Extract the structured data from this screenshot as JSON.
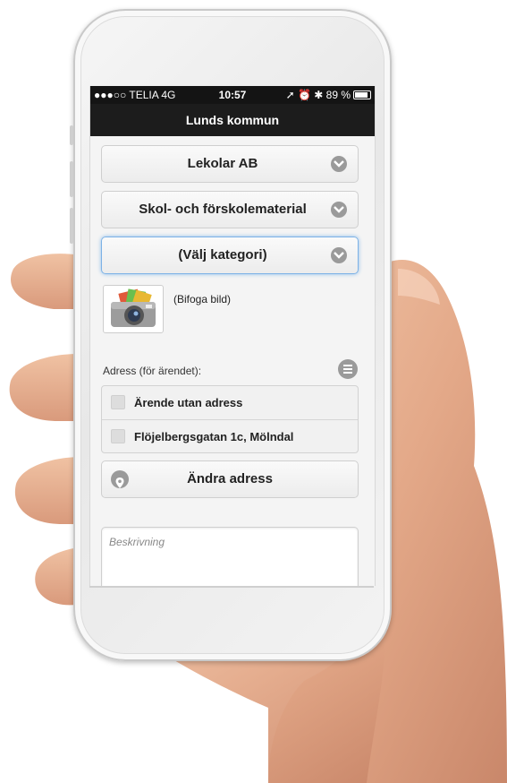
{
  "status_bar": {
    "carrier": "●●●○○ TELIA  4G",
    "time": "10:57",
    "right_indicators": "➚ ⏰ ✱  89 %",
    "battery_percent": 89
  },
  "nav": {
    "title": "Lunds kommun"
  },
  "form": {
    "organisation": {
      "label": "Lekolar AB",
      "icon": "chevron-down-icon"
    },
    "area": {
      "label": "Skol- och förskolematerial",
      "icon": "chevron-down-icon"
    },
    "category": {
      "label": "(Välj kategori)",
      "icon": "chevron-down-icon"
    },
    "attachment": {
      "label": "(Bifoga bild)",
      "icon": "camera-icon"
    },
    "address_section": {
      "label": "Adress (för ärendet):",
      "menu_icon": "list-menu-icon",
      "options": [
        {
          "label": "Ärende utan adress",
          "checked": false
        },
        {
          "label": "Flöjelbergsgatan 1c, Mölndal",
          "checked": false
        }
      ],
      "change_button": {
        "label": "Ändra adress",
        "icon": "map-pin-icon"
      }
    },
    "description": {
      "placeholder": "Beskrivning"
    }
  },
  "colors": {
    "navbar": "#1c1c1c",
    "active_focus": "#7db2e6",
    "icon_grey": "#9a9a9a"
  }
}
